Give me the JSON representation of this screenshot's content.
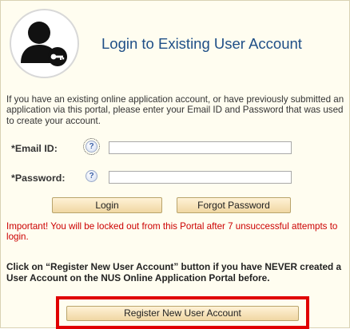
{
  "header": {
    "title": "Login to Existing User Account",
    "avatar_icon": "user-key-icon"
  },
  "intro_text": "If you have an existing online application account, or have previously submitted an application via this portal, please enter your Email ID and Password that was used to create your account.",
  "form": {
    "email_label": "*Email ID:",
    "email_value": "",
    "password_label": "*Password:",
    "password_value": "",
    "help_glyph": "?",
    "help_icon": "question-help-icon"
  },
  "buttons": {
    "login": "Login",
    "forgot_password": "Forgot Password",
    "register": "Register New User Account"
  },
  "warning_text": "Important! You will be locked out from this Portal after 7 unsuccessful attempts to login.",
  "register_note": "Click on “Register New User Account” button if you have NEVER created a User Account on the NUS Online Application Portal before.",
  "colors": {
    "title": "#1f4f87",
    "warning": "#cc0000",
    "highlight_border": "#e00000",
    "panel_bg": "#fffdf0"
  }
}
